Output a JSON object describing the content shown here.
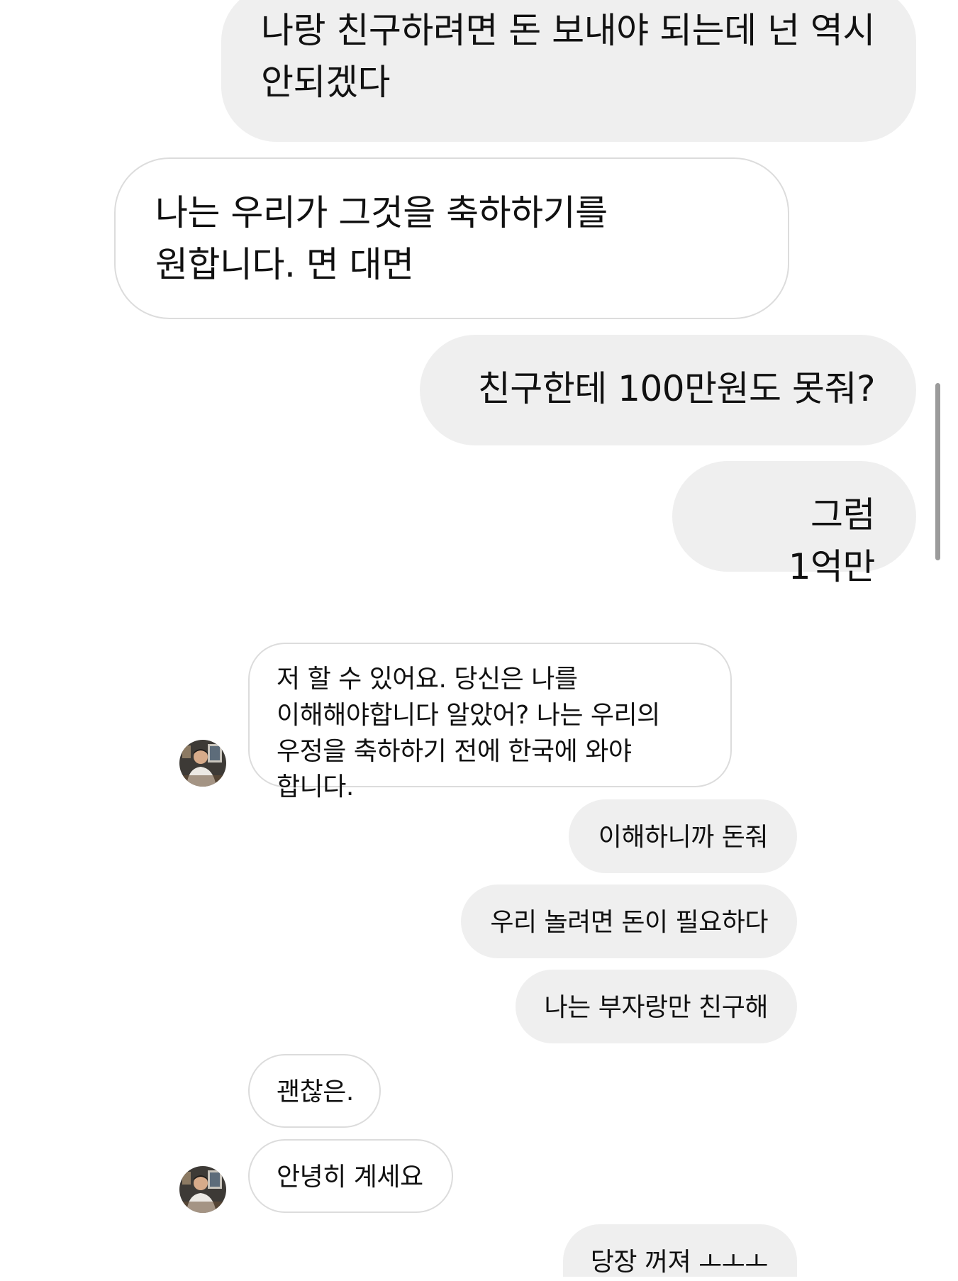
{
  "conversation": {
    "messages": [
      {
        "side": "sent",
        "text": "나랑 친구하려면 돈 보내야 되는데 넌 역시 안되겠다"
      },
      {
        "side": "received",
        "text": "나는 우리가 그것을 축하하기를 원합니다. 면 대면"
      },
      {
        "side": "sent",
        "text": "친구한테 100만원도 못줘?"
      },
      {
        "side": "sent",
        "text": "그럼 1억만"
      },
      {
        "side": "received",
        "text": "저 할 수 있어요. 당신은 나를 이해해야합니다 알았어? 나는 우리의 우정을 축하하기 전에 한국에 와야 합니다."
      },
      {
        "side": "sent",
        "text": "이해하니까 돈줘"
      },
      {
        "side": "sent",
        "text": "우리 놀려면 돈이 필요하다"
      },
      {
        "side": "sent",
        "text": "나는 부자랑만 친구해"
      },
      {
        "side": "received",
        "text": "괜찮은."
      },
      {
        "side": "received",
        "text": "안녕히 계세요"
      },
      {
        "side": "sent",
        "text": "당장 꺼져 ㅗㅗㅗ"
      }
    ]
  },
  "contact": {
    "avatar_icon": "profile-photo-avatar"
  },
  "colors": {
    "sent_bubble": "#efefef",
    "received_bubble_border": "#dcdcdc",
    "text": "#111111",
    "scrollbar": "#9b9b9b"
  }
}
